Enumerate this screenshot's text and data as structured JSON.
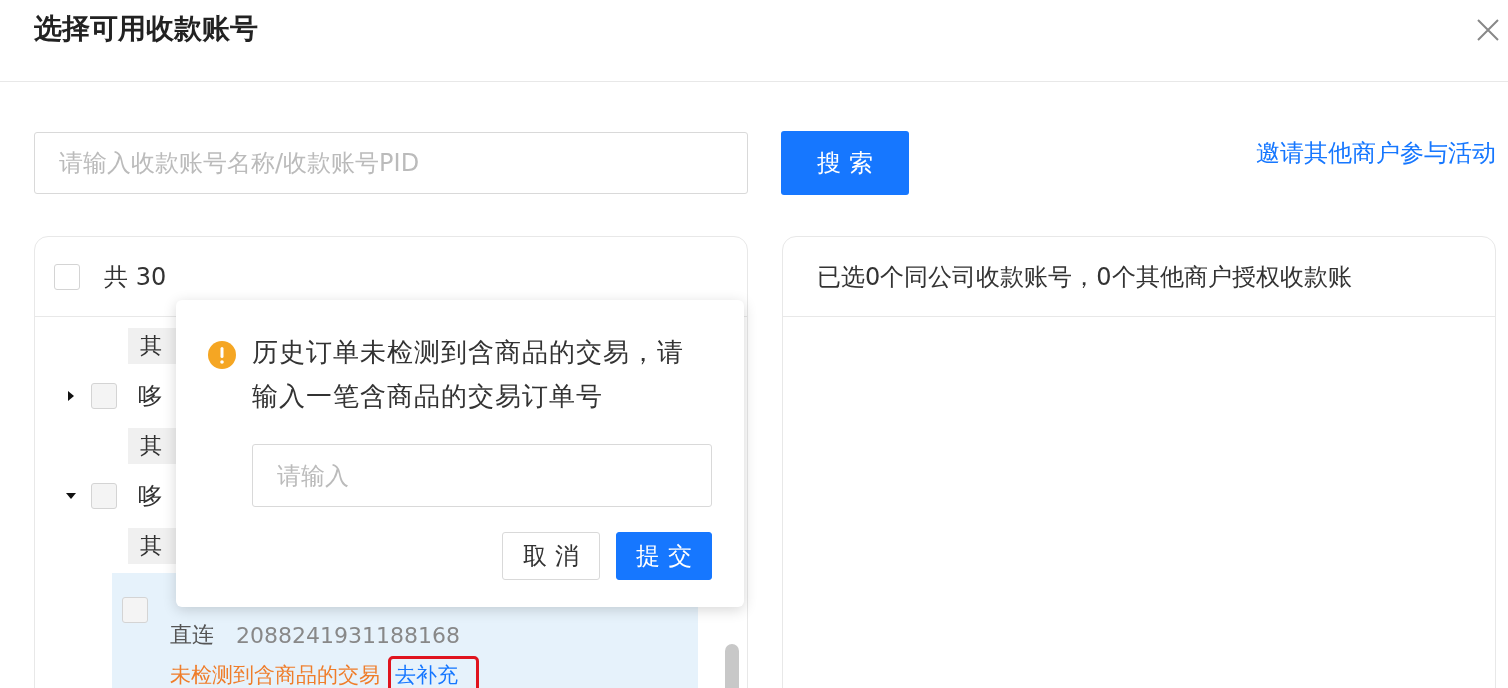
{
  "dialog": {
    "title": "选择可用收款账号"
  },
  "search": {
    "placeholder": "请输入收款账号名称/收款账号PID",
    "button": "搜 索"
  },
  "invite_link": "邀请其他商户参与活动",
  "left_panel": {
    "select_all": {
      "checked": false
    },
    "count": "共 30",
    "items": [
      {
        "kind": "tag",
        "text": "其"
      },
      {
        "kind": "node",
        "expanded": false,
        "checked": false,
        "text": "哆"
      },
      {
        "kind": "tag",
        "text": "其"
      },
      {
        "kind": "node",
        "expanded": true,
        "checked": false,
        "text": "哆"
      },
      {
        "kind": "tag",
        "text": "其"
      },
      {
        "kind": "account",
        "selected": true,
        "checked": false,
        "type": "直连",
        "pid": "2088241931188168",
        "warning": "未检测到含商品的交易",
        "action": "去补充",
        "highlighted": true
      }
    ]
  },
  "right_panel": {
    "summary": "已选0个同公司收款账号，0个其他商户授权收款账"
  },
  "popover": {
    "message": "历史订单未检测到含商品的交易，请输入一笔含商品的交易订单号",
    "placeholder": "请输入",
    "buttons": [
      {
        "label": "取 消",
        "kind": "default"
      },
      {
        "label": "提 交",
        "kind": "primary"
      }
    ]
  }
}
